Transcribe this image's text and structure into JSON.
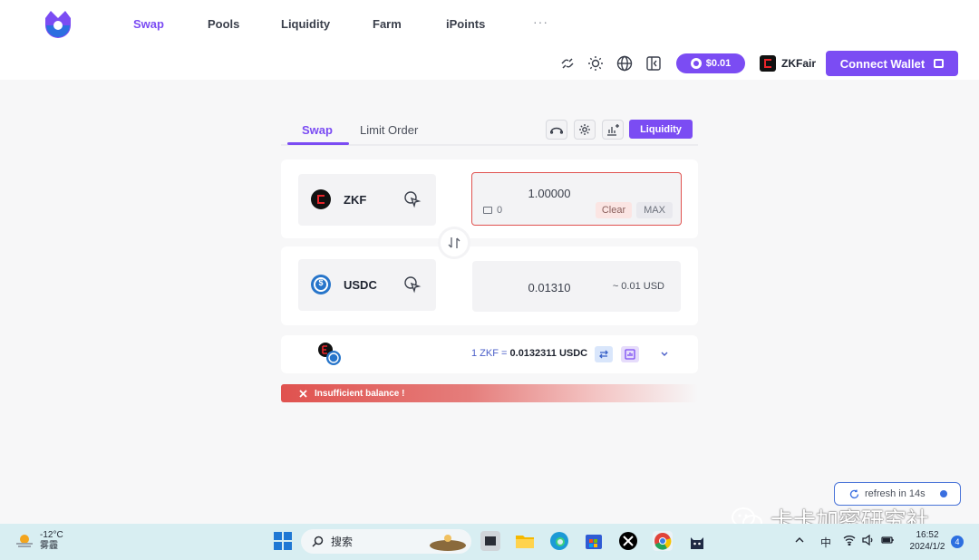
{
  "nav": {
    "items": [
      {
        "label": "Swap",
        "active": true
      },
      {
        "label": "Pools",
        "active": false
      },
      {
        "label": "Liquidity",
        "active": false
      },
      {
        "label": "Farm",
        "active": false
      },
      {
        "label": "iPoints",
        "active": false
      }
    ],
    "more": "···"
  },
  "header": {
    "price": "$0.01",
    "network": "ZKFair",
    "connect_label": "Connect Wallet",
    "icons": [
      "unlink-icon",
      "sun-icon",
      "globe-icon",
      "sidebar-collapse-icon"
    ]
  },
  "swap": {
    "tabs": [
      "Swap",
      "Limit Order"
    ],
    "liquidity_button": "Liquidity",
    "from": {
      "symbol": "ZKF",
      "amount": "1.00000",
      "balance": "0",
      "clear_label": "Clear",
      "max_label": "MAX"
    },
    "to": {
      "symbol": "USDC",
      "amount": "0.01310",
      "usd_value": "~ 0.01 USD"
    },
    "rate": {
      "base": "1 ZKF",
      "equals": "=",
      "quote": "0.0132311 USDC"
    },
    "error": "Insufficient balance !"
  },
  "refresh": {
    "label": "refresh in 14s"
  },
  "watermark": "卡卡加密研究社",
  "colors": {
    "accent": "#7b4cf3",
    "error": "#e0524f",
    "link": "#4a5ec8"
  },
  "taskbar": {
    "weather_temp": "-12°C",
    "weather_desc": "雾霾",
    "search_placeholder": "搜索",
    "ime": "中",
    "time": "16:52",
    "date": "2024/1/2",
    "notifications": "4"
  }
}
